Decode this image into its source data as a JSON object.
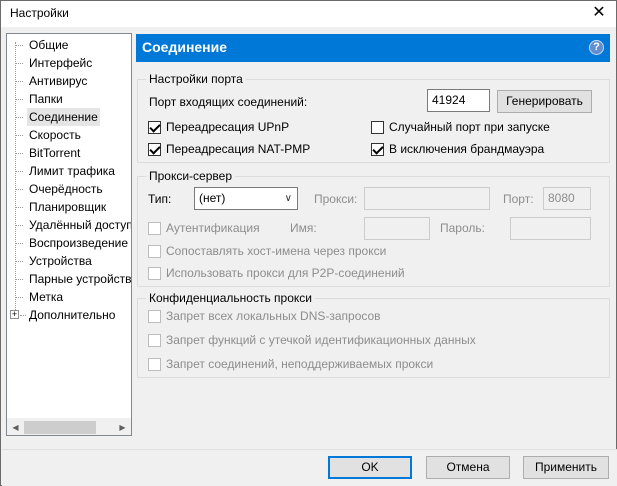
{
  "window": {
    "title": "Настройки",
    "close_glyph": "✕"
  },
  "sidebar": {
    "items": [
      {
        "label": "Общие",
        "selected": false
      },
      {
        "label": "Интерфейс",
        "selected": false
      },
      {
        "label": "Антивирус",
        "selected": false
      },
      {
        "label": "Папки",
        "selected": false
      },
      {
        "label": "Соединение",
        "selected": true
      },
      {
        "label": "Скорость",
        "selected": false
      },
      {
        "label": "BitTorrent",
        "selected": false
      },
      {
        "label": "Лимит трафика",
        "selected": false
      },
      {
        "label": "Очерёдность",
        "selected": false
      },
      {
        "label": "Планировщик",
        "selected": false
      },
      {
        "label": "Удалённый доступ",
        "selected": false
      },
      {
        "label": "Воспроизведение",
        "selected": false
      },
      {
        "label": "Устройства",
        "selected": false
      },
      {
        "label": "Парные устройства",
        "selected": false
      },
      {
        "label": "Метка",
        "selected": false
      },
      {
        "label": "Дополнительно",
        "selected": false,
        "expandable": true
      }
    ],
    "expander_glyph": "+"
  },
  "header": {
    "title": "Соединение",
    "help_glyph": "?"
  },
  "port_settings": {
    "group_title": "Настройки порта",
    "incoming_label": "Порт входящих соединений:",
    "incoming_value": "41924",
    "generate_label": "Генерировать",
    "upnp_label": "Переадресация UPnP",
    "upnp_checked": true,
    "random_port_label": "Случайный порт при запуске",
    "random_port_checked": false,
    "natpmp_label": "Переадресация NAT-PMP",
    "natpmp_checked": true,
    "firewall_label": "В исключения брандмауэра",
    "firewall_checked": true
  },
  "proxy": {
    "group_title": "Прокси-сервер",
    "type_label": "Тип:",
    "type_value": "(нет)",
    "proxy_label": "Прокси:",
    "proxy_value": "",
    "port_label": "Порт:",
    "port_value": "8080",
    "auth_label": "Аутентификация",
    "auth_checked": false,
    "name_label": "Имя:",
    "name_value": "",
    "password_label": "Пароль:",
    "password_value": "",
    "resolve_label": "Сопоставлять хост-имена через прокси",
    "resolve_checked": false,
    "p2p_label": "Использовать прокси для P2P-соединений",
    "p2p_checked": false
  },
  "privacy": {
    "group_title": "Конфиденциальность прокси",
    "dns_label": "Запрет всех локальных DNS-запросов",
    "dns_checked": false,
    "leak_label": "Запрет функций с утечкой идентификационных данных",
    "leak_checked": false,
    "unsupported_label": "Запрет соединений, неподдерживаемых прокси",
    "unsupported_checked": false
  },
  "footer": {
    "ok_label": "OK",
    "cancel_label": "Отмена",
    "apply_label": "Применить"
  }
}
